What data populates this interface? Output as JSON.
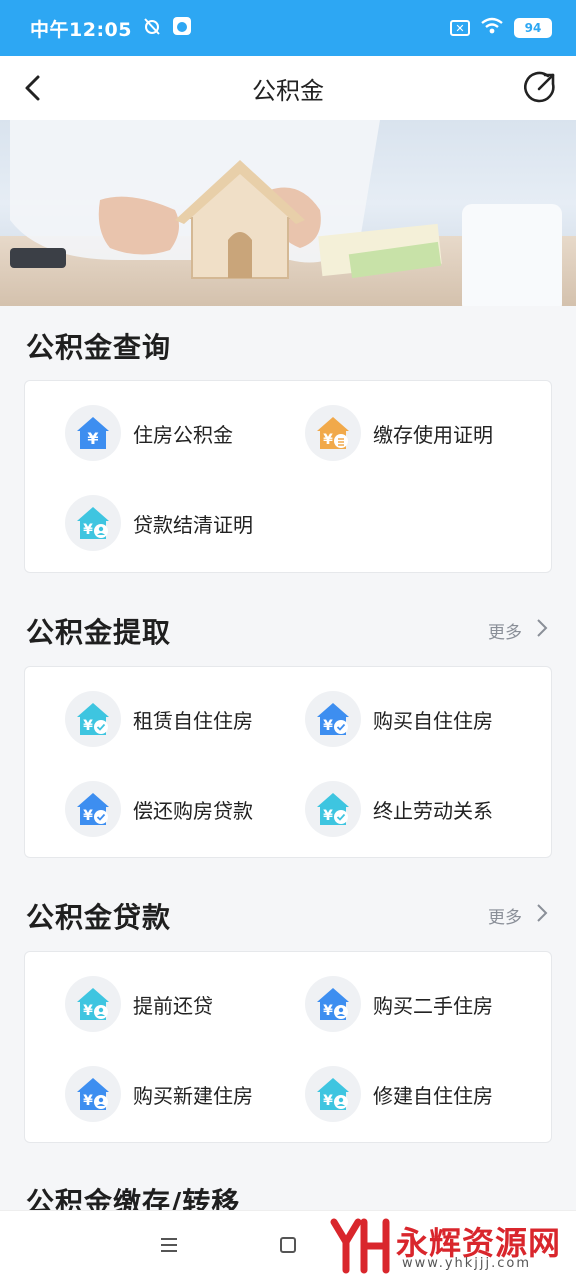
{
  "status_bar": {
    "time": "中午12:05",
    "battery": "94"
  },
  "nav": {
    "title": "公积金"
  },
  "sections": [
    {
      "title": "公积金查询",
      "more": "",
      "items": [
        {
          "label": "住房公积金",
          "icon": "house-yuan-icon"
        },
        {
          "label": "缴存使用证明",
          "icon": "house-yuan-document-icon"
        },
        {
          "label": "贷款结清证明",
          "icon": "house-yuan-person-icon"
        }
      ]
    },
    {
      "title": "公积金提取",
      "more": "更多",
      "items": [
        {
          "label": "租赁自住住房",
          "icon": "house-yuan-check-icon"
        },
        {
          "label": "购买自住住房",
          "icon": "house-yuan-check-icon"
        },
        {
          "label": "偿还购房贷款",
          "icon": "house-yuan-check-icon"
        },
        {
          "label": "终止劳动关系",
          "icon": "house-yuan-check-icon"
        }
      ]
    },
    {
      "title": "公积金贷款",
      "more": "更多",
      "items": [
        {
          "label": "提前还贷",
          "icon": "house-yuan-person-icon"
        },
        {
          "label": "购买二手住房",
          "icon": "house-yuan-person-icon"
        },
        {
          "label": "购买新建住房",
          "icon": "house-yuan-person-icon"
        },
        {
          "label": "修建自住住房",
          "icon": "house-yuan-person-icon"
        }
      ]
    },
    {
      "title": "公积金缴存/转移"
    }
  ],
  "watermark": {
    "text": "永辉资源网",
    "url": "www.yhkjjj.com"
  },
  "colors": {
    "status_bar": "#2da7f3",
    "icon_blue": "#3d8ef0",
    "icon_teal": "#3ec5e0",
    "icon_orange": "#f1a94a",
    "watermark_red": "#d9262c"
  }
}
